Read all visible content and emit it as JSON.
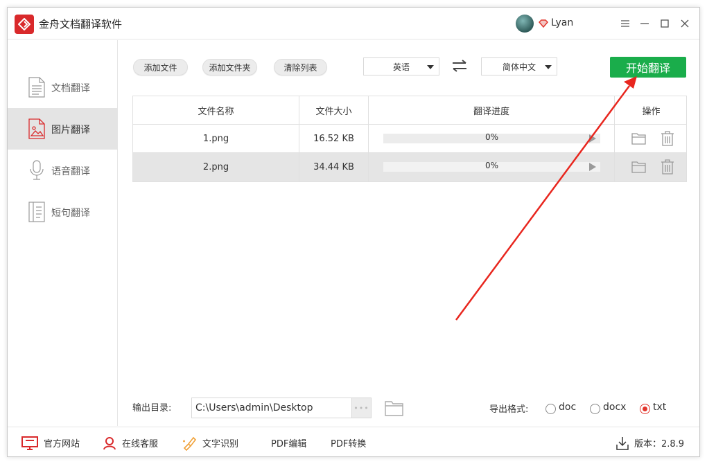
{
  "app": {
    "title": "金舟文档翻译软件",
    "username": "Lyan"
  },
  "sidebar": {
    "items": [
      {
        "label": "文档翻译",
        "icon": "document-icon",
        "active": false
      },
      {
        "label": "图片翻译",
        "icon": "image-icon",
        "active": true
      },
      {
        "label": "语音翻译",
        "icon": "microphone-icon",
        "active": false
      },
      {
        "label": "短句翻译",
        "icon": "sentence-icon",
        "active": false
      }
    ]
  },
  "toolbar": {
    "add_file": "添加文件",
    "add_folder": "添加文件夹",
    "clear_list": "清除列表",
    "source_lang": "英语",
    "target_lang": "简体中文",
    "start": "开始翻译"
  },
  "table": {
    "headers": [
      "文件名称",
      "文件大小",
      "翻译进度",
      "操作"
    ],
    "rows": [
      {
        "name": "1.png",
        "size": "16.52 KB",
        "progress": "0%",
        "progress_value": 0
      },
      {
        "name": "2.png",
        "size": "34.44 KB",
        "progress": "0%",
        "progress_value": 0
      }
    ]
  },
  "output": {
    "label": "输出目录:",
    "path": "C:\\Users\\admin\\Desktop",
    "more": "•••",
    "format_label": "导出格式:",
    "formats": [
      {
        "label": "doc",
        "selected": false
      },
      {
        "label": "docx",
        "selected": false
      },
      {
        "label": "txt",
        "selected": true
      }
    ]
  },
  "footer": {
    "website": "官方网站",
    "support": "在线客服",
    "ocr": "文字识别",
    "pdf_edit": "PDF编辑",
    "pdf_convert": "PDF转换",
    "version": "版本：2.8.9"
  },
  "colors": {
    "brand_red": "#d9292b",
    "start_green": "#1aad4b",
    "annotation_arrow": "#e8261e"
  }
}
